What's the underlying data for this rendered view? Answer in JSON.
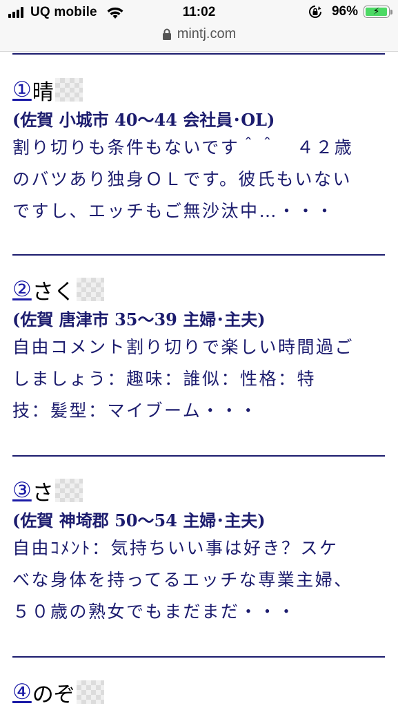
{
  "status_bar": {
    "carrier": "UQ mobile",
    "time": "11:02",
    "battery_percent": "96%",
    "battery_level": 0.96,
    "icons": [
      "signal-icon",
      "wifi-icon",
      "rotation-lock-icon",
      "battery-icon"
    ]
  },
  "browser": {
    "url": "mintj.com",
    "icon": "padlock-icon"
  },
  "entries": [
    {
      "num": "①",
      "name": "晴",
      "meta": "(佐賀 小城市 40～44 会社員･OL)",
      "desc_lines": [
        "割り切りも条件もないです＾＾　４２歳",
        "のバツあり独身ＯＬです。彼氏もいない",
        "ですし、エッチもご無沙汰中…・・・"
      ]
    },
    {
      "num": "②",
      "name": "さく",
      "meta": "(佐賀 唐津市 35～39 主婦･主夫)",
      "desc_lines": [
        "自由コメント割り切りで楽しい時間過ご",
        "しましょう：趣味：誰似：性格：特",
        "技：髪型：マイブーム・・・"
      ]
    },
    {
      "num": "③",
      "name": "さ",
      "meta": "(佐賀 神埼郡 50～54 主婦･主夫)",
      "desc_lines": [
        "自由ｺﾒﾝﾄ：気持ちいい事は好き？スケ",
        "べな身体を持ってるエッチな専業主婦、",
        "５０歳の熟女でもまだまだ・・・"
      ]
    },
    {
      "num": "④",
      "name": "のぞ",
      "meta": "",
      "desc_lines": []
    }
  ],
  "colors": {
    "text_navy": "#1c1c6e",
    "link_blue": "#1a1aa6",
    "battery_green": "#4cd964"
  }
}
